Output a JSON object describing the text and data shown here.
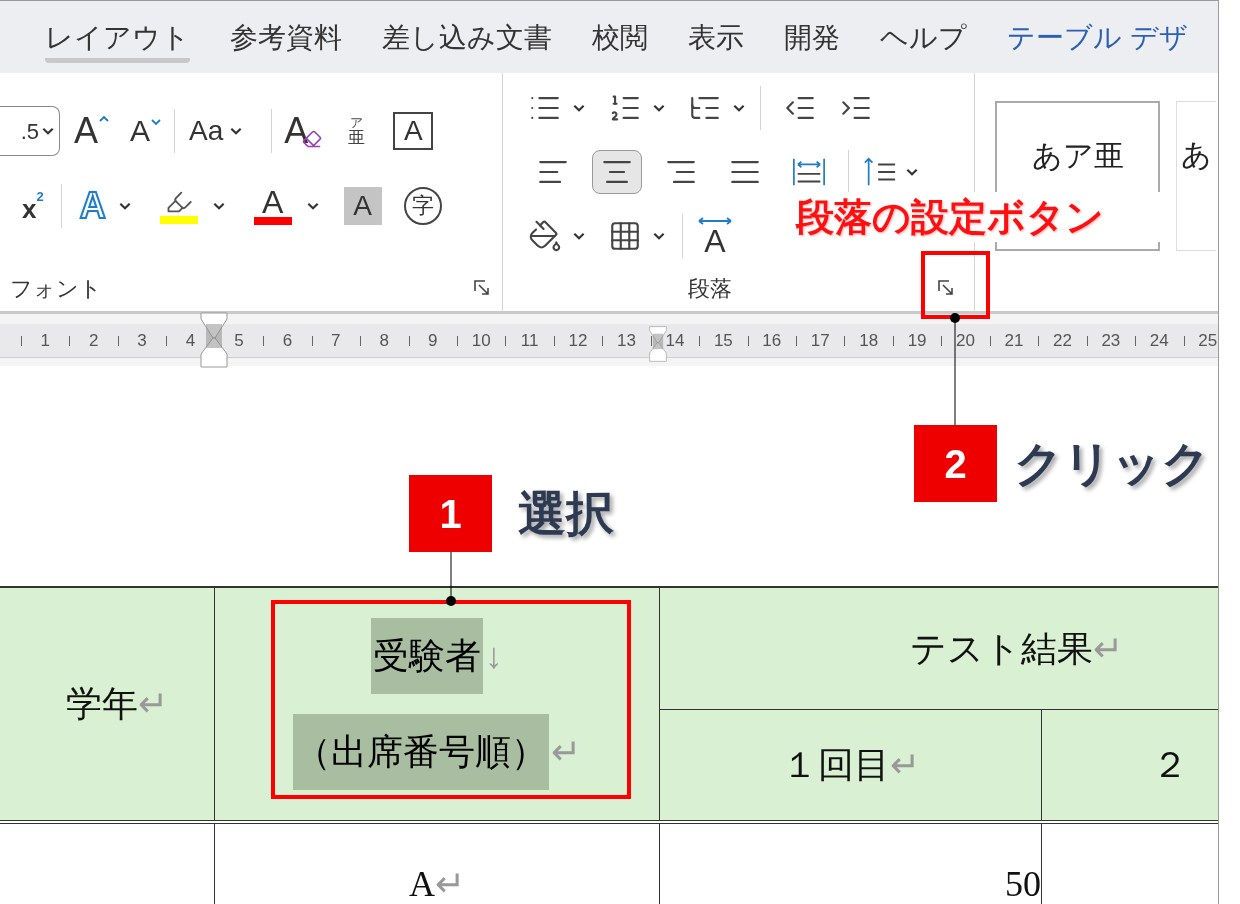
{
  "tabs": [
    {
      "label": "レイアウト",
      "selected": true,
      "kind": "standard"
    },
    {
      "label": "参考資料",
      "selected": false,
      "kind": "standard"
    },
    {
      "label": "差し込み文書",
      "selected": false,
      "kind": "standard"
    },
    {
      "label": "校閲",
      "selected": false,
      "kind": "standard"
    },
    {
      "label": "表示",
      "selected": false,
      "kind": "standard"
    },
    {
      "label": "開発",
      "selected": false,
      "kind": "standard"
    },
    {
      "label": "ヘルプ",
      "selected": false,
      "kind": "standard"
    },
    {
      "label": "テーブル デザ",
      "selected": false,
      "kind": "contextual"
    }
  ],
  "font_group": {
    "label": "フォント",
    "font_size": ".5",
    "grow": "A",
    "shrink": "A",
    "change_case": "Aa",
    "clear_formatting": "A",
    "phonetic_ruby": "ア",
    "phonetic_base": "亜",
    "character_border": "A",
    "superscript_base": "x",
    "superscript_exponent": "2",
    "text_effects": "A",
    "font_color": "A",
    "character_shading": "A",
    "enclosed_character": "字"
  },
  "paragraph_group": {
    "label": "段落",
    "alignment": [
      {
        "kind": "left",
        "selected": false
      },
      {
        "kind": "center",
        "selected": true
      },
      {
        "kind": "right",
        "selected": false
      },
      {
        "kind": "justify",
        "selected": false
      },
      {
        "kind": "distributed",
        "selected": false
      }
    ],
    "asian_layout": "A"
  },
  "styles_group": {
    "styles": [
      {
        "sample": "あア亜"
      },
      {
        "sample": "あ"
      }
    ]
  },
  "ruler": {
    "numbers": [
      "1",
      "2",
      "3",
      "4",
      "5",
      "6",
      "7",
      "8",
      "9",
      "10",
      "11",
      "12",
      "13",
      "14",
      "15",
      "16",
      "17",
      "18",
      "19",
      "20",
      "21",
      "22",
      "23",
      "24",
      "25"
    ]
  },
  "table": {
    "header": [
      {
        "text": "学年",
        "mark": "↵"
      },
      {
        "lines": [
          {
            "text": "受験者",
            "mark": "↓"
          },
          {
            "text": "（出席番号順）",
            "mark": "↵"
          }
        ],
        "selected": true
      },
      {
        "text": "テスト結果",
        "mark": "↵"
      },
      {
        "text": "１回目",
        "mark": "↵"
      },
      {
        "text": "２"
      }
    ],
    "rows": [
      {
        "cells": [
          {},
          {
            "text": "A",
            "mark": "↵"
          },
          {
            "text": "50"
          },
          {}
        ]
      }
    ]
  },
  "annotations": [
    {
      "kind": "callout",
      "text": "段落の設定ボタン"
    },
    {
      "kind": "step",
      "number": "2",
      "label": "クリック"
    },
    {
      "kind": "step",
      "number": "1",
      "label": "選択"
    }
  ]
}
